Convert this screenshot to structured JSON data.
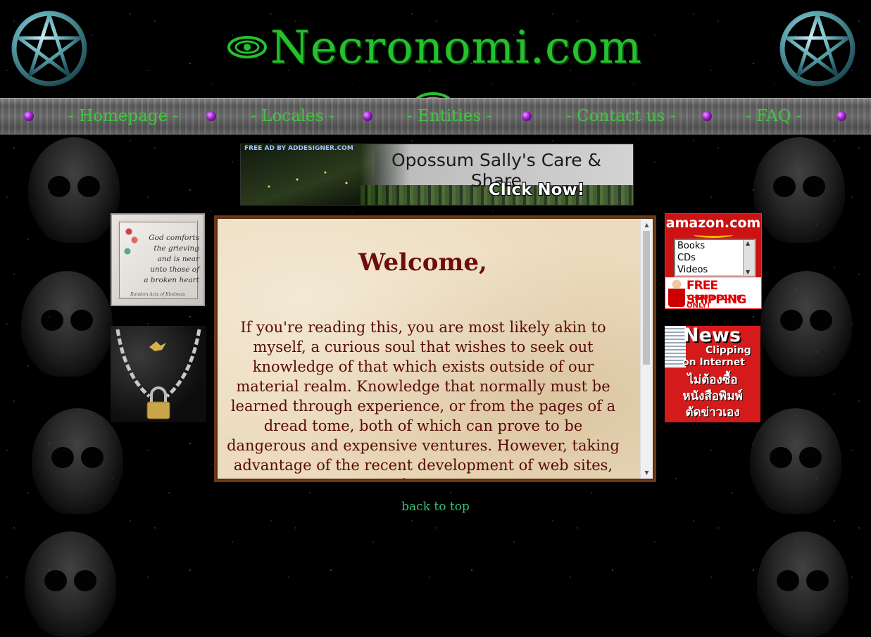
{
  "header": {
    "site_title": "Necronomi.com"
  },
  "nav": {
    "items": [
      {
        "label": "- Homepage -"
      },
      {
        "label": "- Locales -"
      },
      {
        "label": "- Entities -"
      },
      {
        "label": "- Contact us -"
      },
      {
        "label": "- FAQ -"
      }
    ]
  },
  "banner_ad": {
    "ad_by": "FREE AD BY ADDESIGNER.COM",
    "title": "Opossum Sally's Care & Share",
    "cta": "Click Now!"
  },
  "left_images": {
    "comfort": {
      "poem": [
        "God comforts",
        "the grieving",
        "and is near",
        "unto those of",
        "a broken heart"
      ],
      "caption": "Random Acts of Kindness"
    }
  },
  "right_ads": {
    "amazon": {
      "brand": "amazon.com",
      "options": [
        "Books",
        "CDs",
        "Videos"
      ],
      "shipping": "FREE SHIPPING",
      "shipping_sub": "THRU DEC. 10 ONLY!"
    },
    "news": {
      "line1": "News",
      "line2": "Clipping",
      "line3": "on Internet",
      "thai_line1": "ไม่ต้องซื้อ",
      "thai_line2": "หนังสือพิมพ์",
      "thai_line3": "ตัดข่าวเอง"
    }
  },
  "content": {
    "heading": "Welcome,",
    "body": "If you're reading this, you are most likely akin to myself, a curious soul that wishes to seek out knowledge of that which exists outside of our material realm. Knowledge that normally must be learned through experience, or from the pages of a dread tome, both of which can prove to be dangerous and expensive ventures. However, taking advantage of the recent development of web sites, we now make our resources"
  },
  "footer": {
    "back_to_top": "back to top"
  },
  "colors": {
    "title_green": "#23c22d",
    "nav_green": "#3ec83e",
    "heading_maroon": "#6e0d0d",
    "link_green": "#36c270"
  }
}
